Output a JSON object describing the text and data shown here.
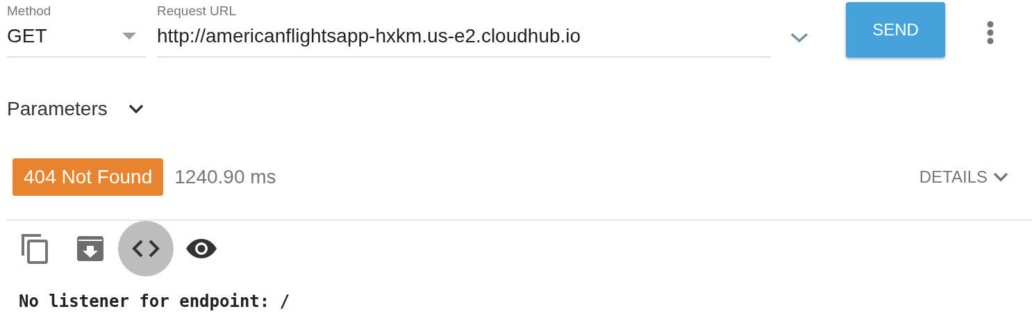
{
  "request": {
    "method_label": "Method",
    "method": "GET",
    "url_label": "Request URL",
    "url": "http://americanflightsapp-hxkm.us-e2.cloudhub.io",
    "send": "SEND"
  },
  "parameters": {
    "label": "Parameters",
    "expanded": false
  },
  "response": {
    "status": "404 Not Found",
    "time": "1240.90 ms",
    "details": "DETAILS",
    "details_expanded": false
  },
  "tools": [
    {
      "kind": "copy",
      "selected": false
    },
    {
      "kind": "save",
      "selected": false
    },
    {
      "kind": "code",
      "selected": true
    },
    {
      "kind": "preview",
      "selected": false
    }
  ],
  "body": "No listener for endpoint: /"
}
